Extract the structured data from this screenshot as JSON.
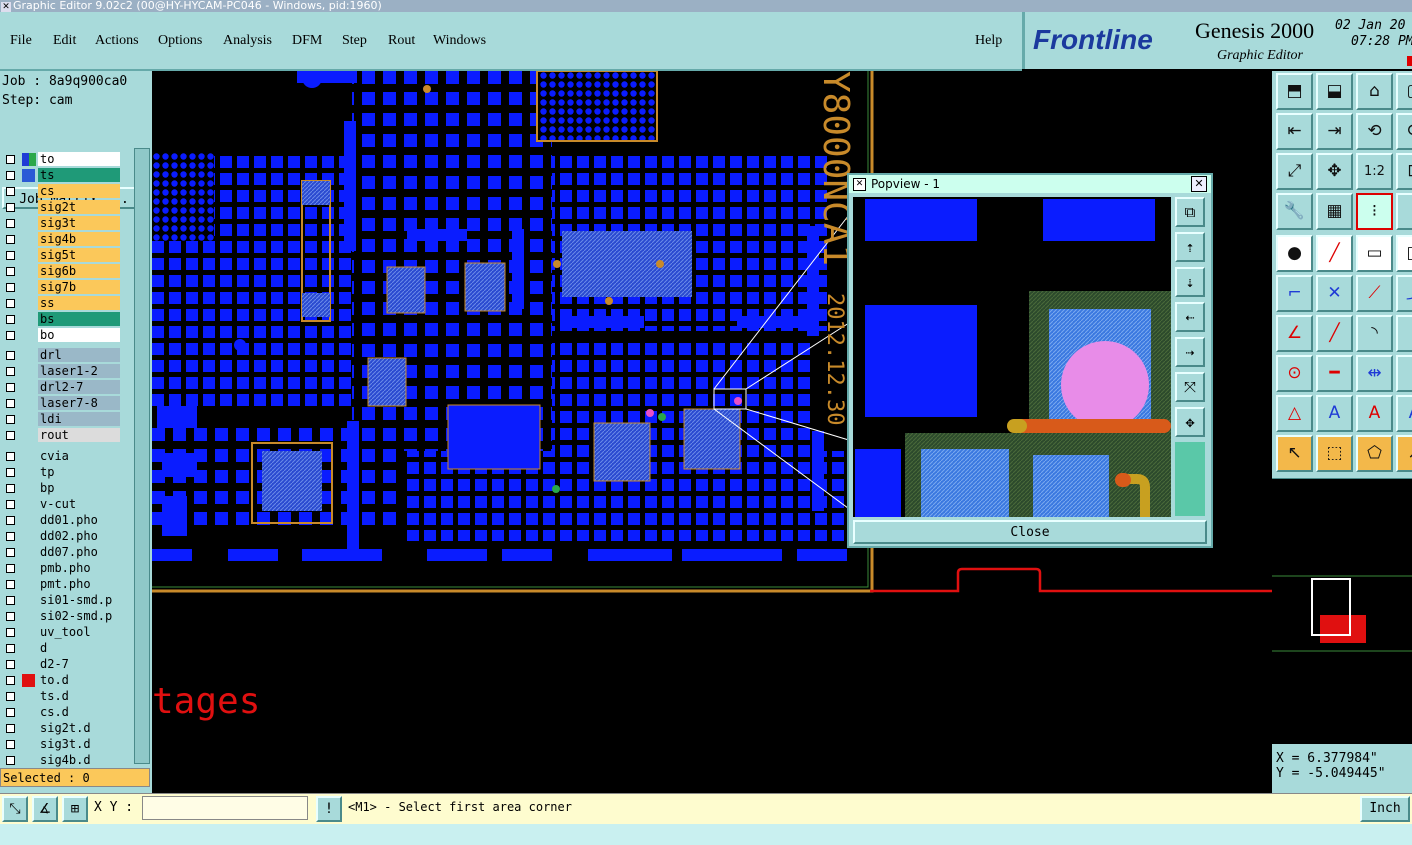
{
  "window": {
    "title": "Graphic Editor 9.02c2 (00@HY-HYCAM-PC046 - Windows, pid:1960)"
  },
  "menu": {
    "file": "File",
    "edit": "Edit",
    "actions": "Actions",
    "options": "Options",
    "analysis": "Analysis",
    "dfm": "DFM",
    "step": "Step",
    "rout": "Rout",
    "windows": "Windows",
    "help": "Help"
  },
  "brand": {
    "frontline": "Frontline",
    "product": "Genesis 2000",
    "subtitle": "Graphic Editor",
    "date": "02 Jan 20",
    "time": "07:28 PM"
  },
  "job": {
    "job_line": "Job : 8a9q900ca0",
    "step_line": "Step: cam",
    "matrix_button": "Job Matrix ..."
  },
  "layers": [
    {
      "name": "to",
      "color": "#ffffff",
      "swatch": "#1f3bd6",
      "swatch2": "#2aa84a"
    },
    {
      "name": "ts",
      "color": "#1f9a78",
      "swatch": "#2a5ad6"
    },
    {
      "name": "cs",
      "color": "#fbc85a"
    },
    {
      "name": "sig2t",
      "color": "#fbc85a"
    },
    {
      "name": "sig3t",
      "color": "#fbc85a"
    },
    {
      "name": "sig4b",
      "color": "#fbc85a"
    },
    {
      "name": "sig5t",
      "color": "#fbc85a"
    },
    {
      "name": "sig6b",
      "color": "#fbc85a"
    },
    {
      "name": "sig7b",
      "color": "#fbc85a"
    },
    {
      "name": "ss",
      "color": "#fbc85a"
    },
    {
      "name": "bs",
      "color": "#1f9a78"
    },
    {
      "name": "bo",
      "color": "#ffffff"
    },
    {
      "name": "drl",
      "color": "#9ab8c8"
    },
    {
      "name": "laser1-2",
      "color": "#9ab8c8"
    },
    {
      "name": "drl2-7",
      "color": "#9ab8c8"
    },
    {
      "name": "laser7-8",
      "color": "#9ab8c8"
    },
    {
      "name": "ldi",
      "color": "#9ab8c8"
    },
    {
      "name": "rout",
      "color": "#dcdcdc"
    },
    {
      "name": "cvia",
      "color": "#a8dada"
    },
    {
      "name": "tp",
      "color": "#a8dada"
    },
    {
      "name": "bp",
      "color": "#a8dada"
    },
    {
      "name": "v-cut",
      "color": "#a8dada"
    },
    {
      "name": "dd01.pho",
      "color": "#a8dada"
    },
    {
      "name": "dd02.pho",
      "color": "#a8dada"
    },
    {
      "name": "dd07.pho",
      "color": "#a8dada"
    },
    {
      "name": "pmb.pho",
      "color": "#a8dada"
    },
    {
      "name": "pmt.pho",
      "color": "#a8dada"
    },
    {
      "name": "si01-smd.p",
      "color": "#a8dada"
    },
    {
      "name": "si02-smd.p",
      "color": "#a8dada"
    },
    {
      "name": "uv_tool",
      "color": "#a8dada"
    },
    {
      "name": "d",
      "color": "#a8dada"
    },
    {
      "name": "d2-7",
      "color": "#a8dada"
    },
    {
      "name": "to.d",
      "color": "#a8dada",
      "swatch": "#e01010"
    },
    {
      "name": "ts.d",
      "color": "#a8dada"
    },
    {
      "name": "cs.d",
      "color": "#a8dada"
    },
    {
      "name": "sig2t.d",
      "color": "#a8dada"
    },
    {
      "name": "sig3t.d",
      "color": "#a8dada"
    },
    {
      "name": "sig4b.d",
      "color": "#a8dada"
    }
  ],
  "status": {
    "selected": "Selected : 0"
  },
  "canvas": {
    "board_text": "Y8000NCA1",
    "date_text": "2012.12.30",
    "stages_text": "tages"
  },
  "popview": {
    "title": "Popview - 1",
    "close_label": "Close"
  },
  "coords": {
    "x": "X = 6.377984\"",
    "y": "Y = -5.049445\""
  },
  "bottom": {
    "xy_label": "X Y :",
    "xy_value": "",
    "message": "<M1> - Select first area corner",
    "unit": "Inch"
  },
  "colors": {
    "panel": "#a8dada",
    "pad_blue": "#0a1cff",
    "trace_red": "#e01010",
    "outline_orange": "#c88a2a"
  }
}
